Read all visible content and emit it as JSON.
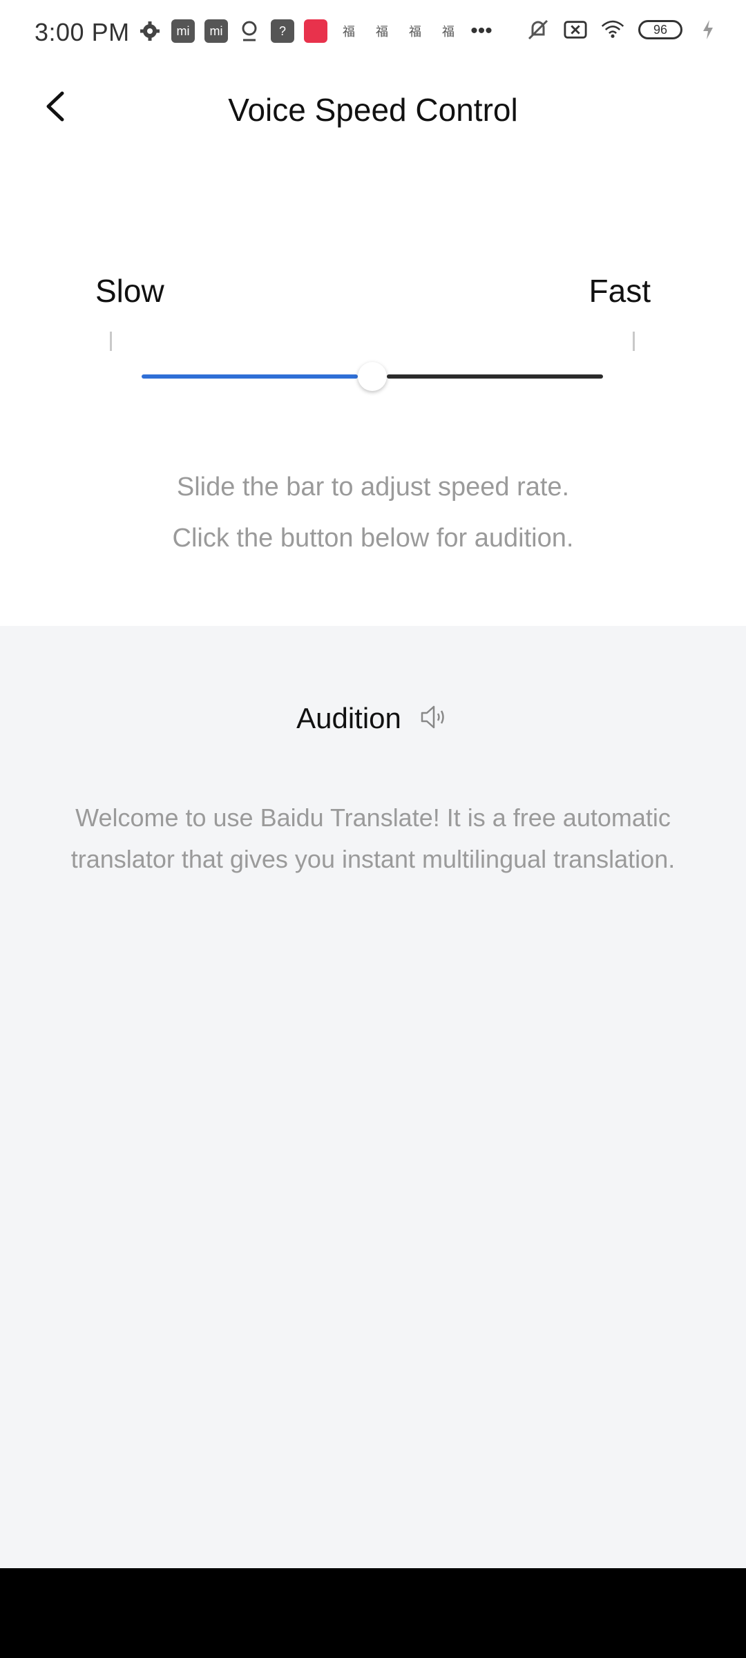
{
  "status_bar": {
    "time": "3:00 PM",
    "battery": "96",
    "left_icons": [
      "settings-icon",
      "mi-store-icon",
      "mi-store-icon",
      "location-pin-icon",
      "question-icon",
      "app-icon",
      "fu-icon",
      "fu-icon",
      "fu-icon",
      "fu-icon",
      "more-dots-icon"
    ],
    "right_icons": [
      "mute-icon",
      "sim-off-icon",
      "wifi-icon",
      "battery-icon",
      "charging-icon"
    ]
  },
  "header": {
    "title": "Voice Speed Control",
    "back_icon": "chevron-left-icon"
  },
  "speed": {
    "slow_label": "Slow",
    "fast_label": "Fast",
    "value": 0.5,
    "accent_color": "#2f6fd6"
  },
  "hints": {
    "line1": "Slide the bar to adjust speed rate.",
    "line2": "Click the button below for audition."
  },
  "audition": {
    "label": "Audition",
    "icon": "speaker-icon",
    "sample_text": "Welcome to use Baidu Translate! It is a free automatic translator that gives you instant multilingual translation."
  }
}
